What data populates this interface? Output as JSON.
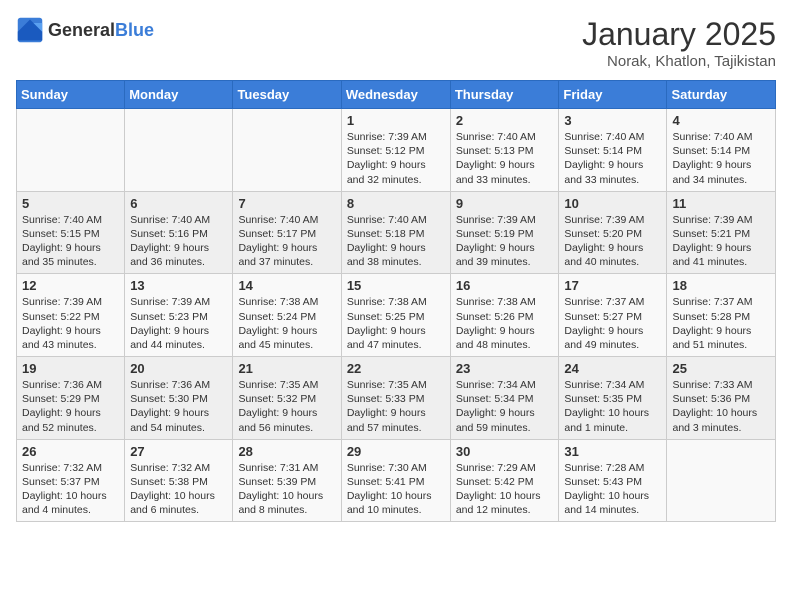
{
  "header": {
    "logo_general": "General",
    "logo_blue": "Blue",
    "title": "January 2025",
    "subtitle": "Norak, Khatlon, Tajikistan"
  },
  "days_of_week": [
    "Sunday",
    "Monday",
    "Tuesday",
    "Wednesday",
    "Thursday",
    "Friday",
    "Saturday"
  ],
  "weeks": [
    [
      {
        "day": "",
        "info": ""
      },
      {
        "day": "",
        "info": ""
      },
      {
        "day": "",
        "info": ""
      },
      {
        "day": "1",
        "info": "Sunrise: 7:39 AM\nSunset: 5:12 PM\nDaylight: 9 hours and 32 minutes."
      },
      {
        "day": "2",
        "info": "Sunrise: 7:40 AM\nSunset: 5:13 PM\nDaylight: 9 hours and 33 minutes."
      },
      {
        "day": "3",
        "info": "Sunrise: 7:40 AM\nSunset: 5:14 PM\nDaylight: 9 hours and 33 minutes."
      },
      {
        "day": "4",
        "info": "Sunrise: 7:40 AM\nSunset: 5:14 PM\nDaylight: 9 hours and 34 minutes."
      }
    ],
    [
      {
        "day": "5",
        "info": "Sunrise: 7:40 AM\nSunset: 5:15 PM\nDaylight: 9 hours and 35 minutes."
      },
      {
        "day": "6",
        "info": "Sunrise: 7:40 AM\nSunset: 5:16 PM\nDaylight: 9 hours and 36 minutes."
      },
      {
        "day": "7",
        "info": "Sunrise: 7:40 AM\nSunset: 5:17 PM\nDaylight: 9 hours and 37 minutes."
      },
      {
        "day": "8",
        "info": "Sunrise: 7:40 AM\nSunset: 5:18 PM\nDaylight: 9 hours and 38 minutes."
      },
      {
        "day": "9",
        "info": "Sunrise: 7:39 AM\nSunset: 5:19 PM\nDaylight: 9 hours and 39 minutes."
      },
      {
        "day": "10",
        "info": "Sunrise: 7:39 AM\nSunset: 5:20 PM\nDaylight: 9 hours and 40 minutes."
      },
      {
        "day": "11",
        "info": "Sunrise: 7:39 AM\nSunset: 5:21 PM\nDaylight: 9 hours and 41 minutes."
      }
    ],
    [
      {
        "day": "12",
        "info": "Sunrise: 7:39 AM\nSunset: 5:22 PM\nDaylight: 9 hours and 43 minutes."
      },
      {
        "day": "13",
        "info": "Sunrise: 7:39 AM\nSunset: 5:23 PM\nDaylight: 9 hours and 44 minutes."
      },
      {
        "day": "14",
        "info": "Sunrise: 7:38 AM\nSunset: 5:24 PM\nDaylight: 9 hours and 45 minutes."
      },
      {
        "day": "15",
        "info": "Sunrise: 7:38 AM\nSunset: 5:25 PM\nDaylight: 9 hours and 47 minutes."
      },
      {
        "day": "16",
        "info": "Sunrise: 7:38 AM\nSunset: 5:26 PM\nDaylight: 9 hours and 48 minutes."
      },
      {
        "day": "17",
        "info": "Sunrise: 7:37 AM\nSunset: 5:27 PM\nDaylight: 9 hours and 49 minutes."
      },
      {
        "day": "18",
        "info": "Sunrise: 7:37 AM\nSunset: 5:28 PM\nDaylight: 9 hours and 51 minutes."
      }
    ],
    [
      {
        "day": "19",
        "info": "Sunrise: 7:36 AM\nSunset: 5:29 PM\nDaylight: 9 hours and 52 minutes."
      },
      {
        "day": "20",
        "info": "Sunrise: 7:36 AM\nSunset: 5:30 PM\nDaylight: 9 hours and 54 minutes."
      },
      {
        "day": "21",
        "info": "Sunrise: 7:35 AM\nSunset: 5:32 PM\nDaylight: 9 hours and 56 minutes."
      },
      {
        "day": "22",
        "info": "Sunrise: 7:35 AM\nSunset: 5:33 PM\nDaylight: 9 hours and 57 minutes."
      },
      {
        "day": "23",
        "info": "Sunrise: 7:34 AM\nSunset: 5:34 PM\nDaylight: 9 hours and 59 minutes."
      },
      {
        "day": "24",
        "info": "Sunrise: 7:34 AM\nSunset: 5:35 PM\nDaylight: 10 hours and 1 minute."
      },
      {
        "day": "25",
        "info": "Sunrise: 7:33 AM\nSunset: 5:36 PM\nDaylight: 10 hours and 3 minutes."
      }
    ],
    [
      {
        "day": "26",
        "info": "Sunrise: 7:32 AM\nSunset: 5:37 PM\nDaylight: 10 hours and 4 minutes."
      },
      {
        "day": "27",
        "info": "Sunrise: 7:32 AM\nSunset: 5:38 PM\nDaylight: 10 hours and 6 minutes."
      },
      {
        "day": "28",
        "info": "Sunrise: 7:31 AM\nSunset: 5:39 PM\nDaylight: 10 hours and 8 minutes."
      },
      {
        "day": "29",
        "info": "Sunrise: 7:30 AM\nSunset: 5:41 PM\nDaylight: 10 hours and 10 minutes."
      },
      {
        "day": "30",
        "info": "Sunrise: 7:29 AM\nSunset: 5:42 PM\nDaylight: 10 hours and 12 minutes."
      },
      {
        "day": "31",
        "info": "Sunrise: 7:28 AM\nSunset: 5:43 PM\nDaylight: 10 hours and 14 minutes."
      },
      {
        "day": "",
        "info": ""
      }
    ]
  ]
}
